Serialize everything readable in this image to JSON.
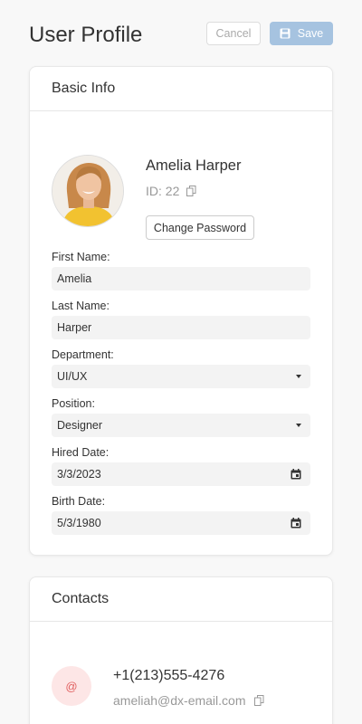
{
  "header": {
    "title": "User Profile",
    "cancel_label": "Cancel",
    "save_label": "Save"
  },
  "basic_info": {
    "title": "Basic Info",
    "name": "Amelia Harper",
    "id_text": "ID: 22",
    "change_password_label": "Change Password",
    "fields": {
      "first_name": {
        "label": "First Name:",
        "value": "Amelia"
      },
      "last_name": {
        "label": "Last Name:",
        "value": "Harper"
      },
      "department": {
        "label": "Department:",
        "value": "UI/UX"
      },
      "position": {
        "label": "Position:",
        "value": "Designer"
      },
      "hired_date": {
        "label": "Hired Date:",
        "value": "3/3/2023"
      },
      "birth_date": {
        "label": "Birth Date:",
        "value": "5/3/1980"
      }
    }
  },
  "contacts": {
    "title": "Contacts",
    "avatar_symbol": "@",
    "phone": "+1(213)555-4276",
    "email": "ameliah@dx-email.com"
  },
  "colors": {
    "save_button_bg": "#a6c3e0",
    "contact_avatar_bg": "#fde6e6",
    "contact_avatar_fg": "#e16161"
  },
  "icons": [
    "save-icon",
    "copy-icon",
    "caret-down-icon",
    "calendar-icon"
  ]
}
